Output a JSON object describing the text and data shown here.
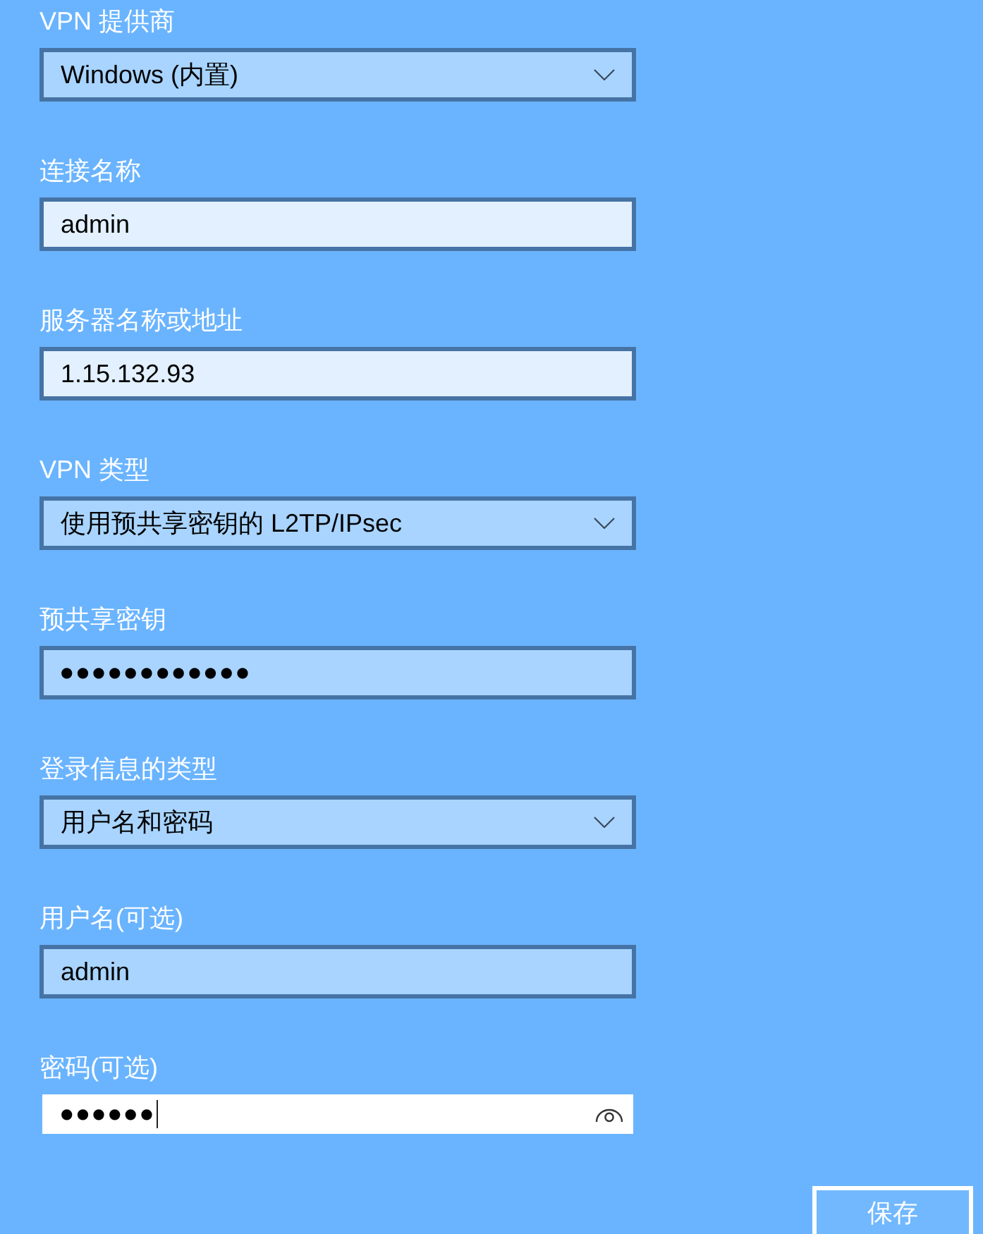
{
  "fields": [
    {
      "label": "VPN 提供商",
      "kind": "select",
      "value": "Windows (内置)",
      "tinted": true,
      "focused": false
    },
    {
      "label": "连接名称",
      "kind": "text",
      "value": "admin",
      "tinted": false,
      "focused": false
    },
    {
      "label": "服务器名称或地址",
      "kind": "text",
      "value": "1.15.132.93",
      "tinted": false,
      "focused": false
    },
    {
      "label": "VPN 类型",
      "kind": "select",
      "value": "使用预共享密钥的 L2TP/IPsec",
      "tinted": true,
      "focused": false
    },
    {
      "label": "预共享密钥",
      "kind": "password",
      "value": "●●●●●●●●●●●●",
      "tinted": true,
      "focused": false
    },
    {
      "label": "登录信息的类型",
      "kind": "select",
      "value": "用户名和密码",
      "tinted": true,
      "focused": false
    },
    {
      "label": "用户名(可选)",
      "kind": "text",
      "value": "admin",
      "tinted": true,
      "focused": false
    },
    {
      "label": "密码(可选)",
      "kind": "password",
      "value": "●●●●●●",
      "focused": true
    }
  ],
  "save_button": {
    "label": "保存"
  }
}
